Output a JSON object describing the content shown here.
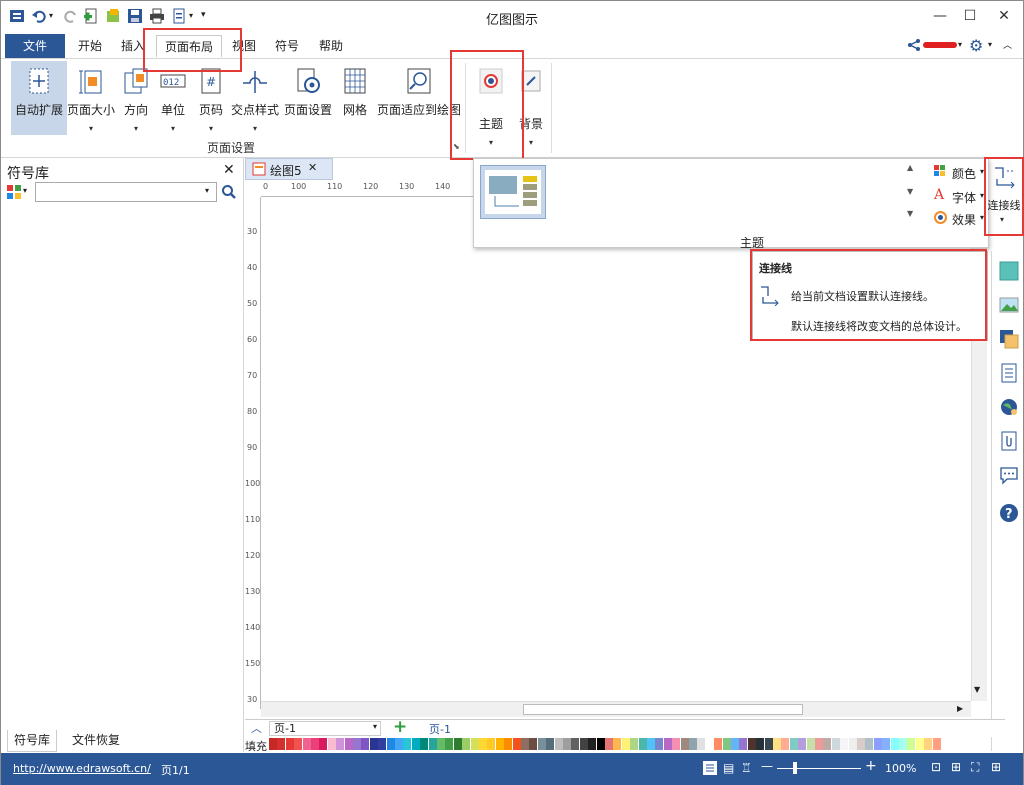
{
  "window": {
    "title": "亿图图示"
  },
  "quick_access": [
    "app-icon",
    "undo-icon",
    "redo-icon",
    "new-icon",
    "open-icon",
    "save-icon",
    "print-icon",
    "export-icon",
    "more-icon"
  ],
  "menu": {
    "tabs": [
      "文件",
      "开始",
      "插入",
      "页面布局",
      "视图",
      "符号",
      "帮助"
    ],
    "active": "页面布局"
  },
  "ribbon": {
    "page_setup": {
      "buttons": [
        "自动扩展",
        "页面大小",
        "方向",
        "单位",
        "页码",
        "交点样式",
        "页面设置",
        "网格",
        "页面适应到绘图"
      ],
      "group_label": "页面设置"
    },
    "theme": {
      "label": "主题"
    },
    "background": {
      "label": "背景"
    },
    "side": {
      "color": "颜色",
      "font": "字体",
      "effect": "效果",
      "connector": "连接线"
    }
  },
  "theme_panel": {
    "label": "主题"
  },
  "tooltip": {
    "title": "连接线",
    "line1": "给当前文档设置默认连接线。",
    "line2": "默认连接线将改变文档的总体设计。"
  },
  "left_panel": {
    "title": "符号库",
    "search_value": "",
    "tabs": [
      "符号库",
      "文件恢复"
    ]
  },
  "doc_tab": {
    "name": "绘图5"
  },
  "ruler": {
    "h": [
      "0",
      "100",
      "110",
      "120",
      "130",
      "140"
    ],
    "v": [
      "30",
      "40",
      "50",
      "60",
      "70",
      "80",
      "90",
      "100",
      "110",
      "120",
      "130",
      "140",
      "150",
      "30"
    ]
  },
  "page_bar": {
    "page_select": "页-1",
    "page_tab": "页-1",
    "fill_label": "填充"
  },
  "status": {
    "url": "http://www.edrawsoft.cn/",
    "page": "页1/1",
    "zoom": "100%"
  },
  "colors": {
    "accent": "#2b5797",
    "annotation": "#e53935"
  }
}
